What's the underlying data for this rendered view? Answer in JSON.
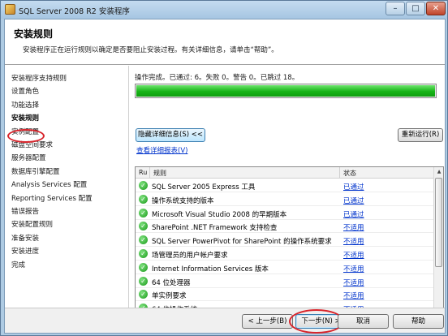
{
  "window": {
    "title": "SQL Server 2008 R2 安装程序",
    "min_glyph": "–",
    "max_glyph": "□",
    "close_glyph": "✕"
  },
  "header": {
    "title": "安装规则",
    "description": "安装程序正在运行规则以确定是否要阻止安装过程。有关详细信息，请单击“帮助”。"
  },
  "sidebar": {
    "items": [
      {
        "label": "安装程序支持规则",
        "active": false
      },
      {
        "label": "设置角色",
        "active": false
      },
      {
        "label": "功能选择",
        "active": false
      },
      {
        "label": "安装规则",
        "active": true
      },
      {
        "label": "实例配置",
        "active": false
      },
      {
        "label": "磁盘空间要求",
        "active": false
      },
      {
        "label": "服务器配置",
        "active": false
      },
      {
        "label": "数据库引擎配置",
        "active": false
      },
      {
        "label": "Analysis Services 配置",
        "active": false
      },
      {
        "label": "Reporting Services 配置",
        "active": false
      },
      {
        "label": "错误报告",
        "active": false
      },
      {
        "label": "安装配置规则",
        "active": false
      },
      {
        "label": "准备安装",
        "active": false
      },
      {
        "label": "安装进度",
        "active": false
      },
      {
        "label": "完成",
        "active": false
      }
    ]
  },
  "main": {
    "status_text": "操作完成。已通过: 6。失败 0。警告 0。已跳过 18。",
    "progress": 1.0,
    "hide_details_label": "隐藏详细信息(S) <<",
    "rerun_label": "重新运行(R)",
    "view_report_label": "查看详细报表(V)",
    "columns": {
      "ru": "Ru",
      "rule": "规则",
      "status": "状态"
    },
    "rows": [
      {
        "rule": "SQL Server 2005 Express 工具",
        "status": "已通过"
      },
      {
        "rule": "操作系统支持的版本",
        "status": "已通过"
      },
      {
        "rule": "Microsoft Visual Studio 2008 的早期版本",
        "status": "已通过"
      },
      {
        "rule": "SharePoint .NET Framework 支持检查",
        "status": "不适用"
      },
      {
        "rule": "SQL Server PowerPivot for SharePoint 的操作系统要求",
        "status": "不适用"
      },
      {
        "rule": "场管理员的用户帐户要求",
        "status": "不适用"
      },
      {
        "rule": "Internet Information Services 版本",
        "status": "不适用"
      },
      {
        "rule": "64 位处理器",
        "status": "不适用"
      },
      {
        "rule": "单实例要求",
        "status": "不适用"
      },
      {
        "rule": "64 位操作系统",
        "status": "不适用"
      }
    ],
    "ok_glyph": "✓",
    "scroll_up": "▲",
    "scroll_down": "▼"
  },
  "footer": {
    "back_label": "< 上一步(B)",
    "next_label": "下一步(N) >",
    "cancel_label": "取消",
    "help_label": "帮助"
  },
  "colors": {
    "progress_fill": "#16b416",
    "highlight_circle": "#d8242b",
    "link": "#0033cc"
  }
}
